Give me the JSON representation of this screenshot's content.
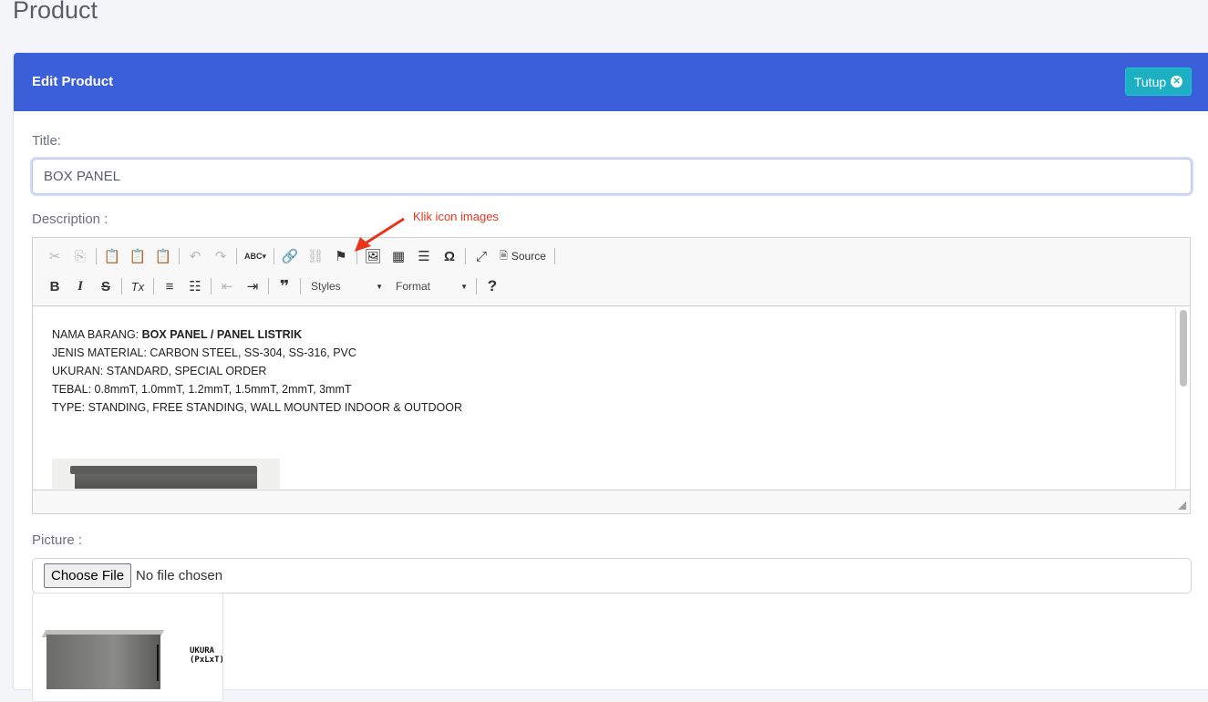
{
  "page": {
    "title": "Product"
  },
  "card": {
    "header_title": "Edit Product",
    "close_label": "Tutup"
  },
  "form": {
    "title_label": "Title:",
    "title_value": "BOX PANEL",
    "description_label": "Description :",
    "picture_label": "Picture :"
  },
  "toolbar": {
    "row1": [
      {
        "name": "cut-icon",
        "glyph": "✂",
        "disabled": true
      },
      {
        "name": "copy-icon",
        "glyph": "⎘",
        "disabled": true
      },
      {
        "name": "paste-icon",
        "glyph": "📋",
        "disabled": false
      },
      {
        "name": "paste-text-icon",
        "glyph": "📋",
        "disabled": false
      },
      {
        "name": "paste-word-icon",
        "glyph": "📋",
        "disabled": false
      },
      {
        "name": "undo-icon",
        "glyph": "↶",
        "disabled": true
      },
      {
        "name": "redo-icon",
        "glyph": "↷",
        "disabled": true
      },
      {
        "name": "spellcheck-icon",
        "glyph": "ABC",
        "disabled": false
      },
      {
        "name": "link-icon",
        "glyph": "🔗",
        "disabled": false
      },
      {
        "name": "unlink-icon",
        "glyph": "⛓",
        "disabled": true
      },
      {
        "name": "anchor-flag-icon",
        "glyph": "⚑",
        "disabled": false
      },
      {
        "name": "image-icon",
        "glyph": "🖼",
        "disabled": false
      },
      {
        "name": "table-icon",
        "glyph": "▦",
        "disabled": false
      },
      {
        "name": "horizontal-line-icon",
        "glyph": "☰",
        "disabled": false
      },
      {
        "name": "special-char-icon",
        "glyph": "Ω",
        "disabled": false
      },
      {
        "name": "maximize-icon",
        "glyph": "⤢",
        "disabled": false
      }
    ],
    "source_label": "Source",
    "row2": [
      {
        "name": "bold-icon",
        "glyph": "B"
      },
      {
        "name": "italic-icon",
        "glyph": "I"
      },
      {
        "name": "strike-icon",
        "glyph": "S"
      },
      {
        "name": "remove-format-icon",
        "glyph": "Tx"
      },
      {
        "name": "numbered-list-icon",
        "glyph": "≡"
      },
      {
        "name": "bulleted-list-icon",
        "glyph": "☷"
      },
      {
        "name": "outdent-icon",
        "glyph": "⇤"
      },
      {
        "name": "indent-icon",
        "glyph": "⇥"
      },
      {
        "name": "blockquote-icon",
        "glyph": "❞"
      }
    ],
    "styles_label": "Styles",
    "format_label": "Format",
    "help_glyph": "?"
  },
  "editor": {
    "lines": [
      {
        "prefix": "NAMA BARANG: ",
        "bold": "BOX PANEL / PANEL LISTRIK"
      },
      {
        "prefix": "JENIS MATERIAL: CARBON STEEL, SS-304, SS-316, PVC",
        "bold": ""
      },
      {
        "prefix": "UKURAN: STANDARD, SPECIAL ORDER",
        "bold": ""
      },
      {
        "prefix": "TEBAL: 0.8mmT, 1.0mmT, 1.2mmT, 1.5mmT, 2mmT, 3mmT",
        "bold": ""
      },
      {
        "prefix": "TYPE: STANDING, FREE STANDING, WALL MOUNTED INDOOR & OUTDOOR",
        "bold": ""
      }
    ]
  },
  "file": {
    "button_label": "Choose File",
    "status": "No file chosen"
  },
  "preview": {
    "spec_line1": "UKURA",
    "spec_line2": "(PxLxT)"
  },
  "annotation": {
    "text": "Klik icon images",
    "color": "#e8341b"
  },
  "colors": {
    "header_bg": "#3b5fd9",
    "close_button_bg": "#1cb0c2"
  }
}
